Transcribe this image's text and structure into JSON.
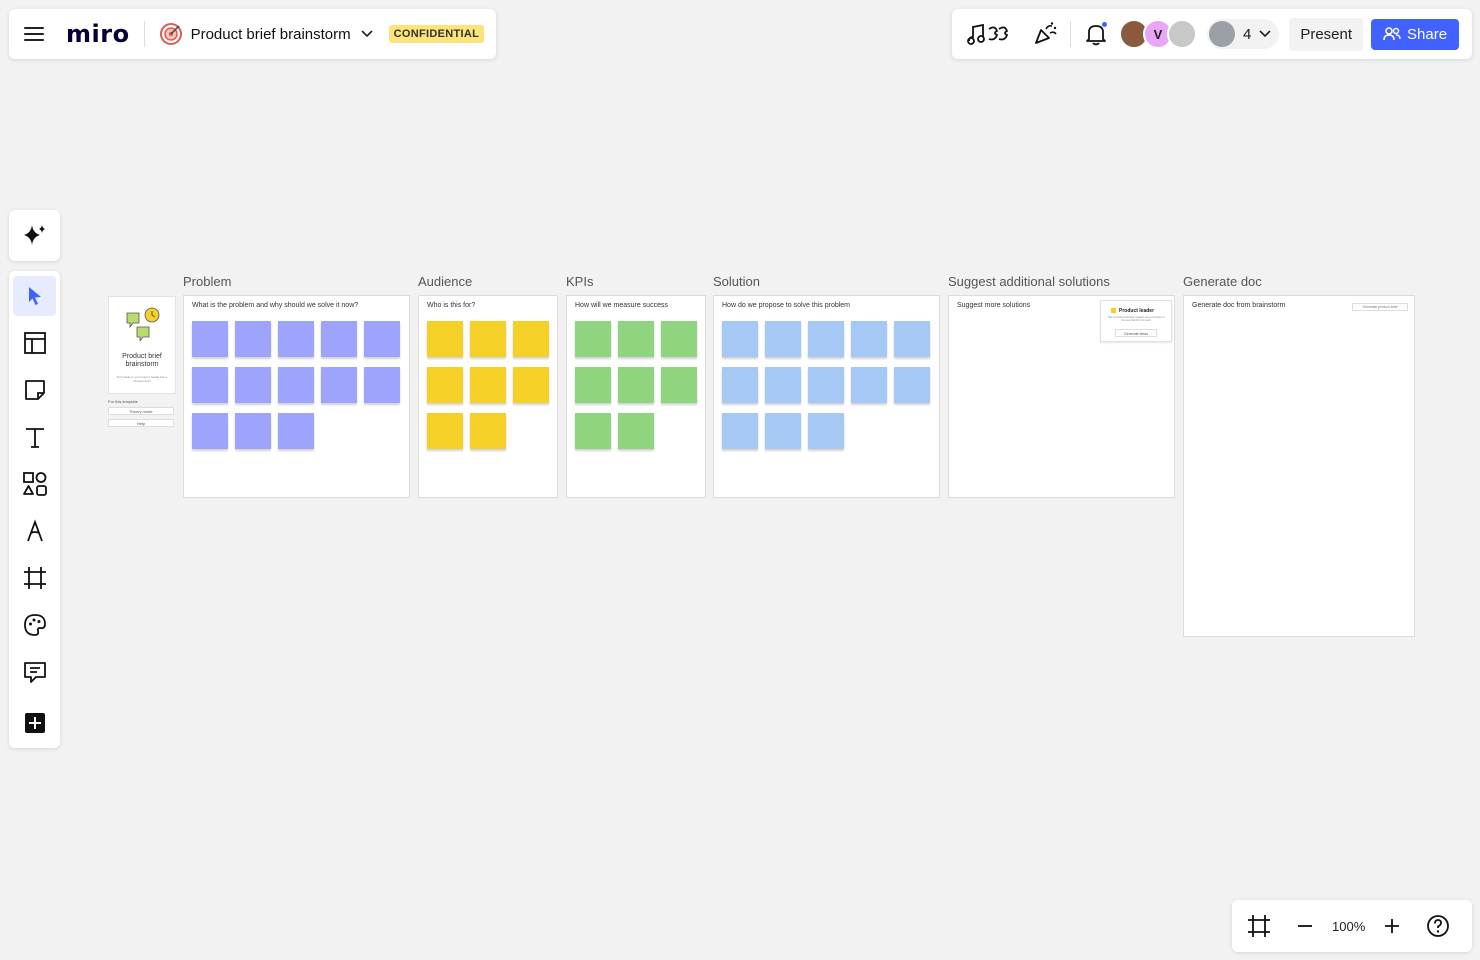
{
  "app": {
    "logo": "miro"
  },
  "board": {
    "title": "Product brief brainstorm",
    "badge": "CONFIDENTIAL"
  },
  "header": {
    "collaborators_count": "4",
    "avatars": [
      {
        "initial": "",
        "color": "#8a5a3c"
      },
      {
        "initial": "V",
        "color": "#e9a6f5"
      },
      {
        "initial": "",
        "color": "#c8c8c8"
      }
    ],
    "present_label": "Present",
    "share_label": "Share"
  },
  "toolbar": {
    "tools": [
      "ai-sparkle",
      "select",
      "templates",
      "sticky-note",
      "text",
      "shapes",
      "pen",
      "frame",
      "stickers",
      "comment",
      "more"
    ]
  },
  "zoom": {
    "level": "100%"
  },
  "thumbnail": {
    "title": "Product brief brainstorm",
    "subtitle": "Turn ideas in your team's heads into a Product brief",
    "section_label": "For this template",
    "button1": "Theory mode",
    "button2": "Help"
  },
  "frames": [
    {
      "label": "Problem",
      "question": "What is the problem and why should we solve it now?",
      "color": "purple",
      "notes": 13
    },
    {
      "label": "Audience",
      "question": "Who is this for?",
      "color": "yellow",
      "notes": 8
    },
    {
      "label": "KPIs",
      "question": "How will we measure success",
      "color": "green",
      "notes": 8
    },
    {
      "label": "Solution",
      "question": "How do we propose to solve this problem",
      "color": "blue",
      "notes": 13
    },
    {
      "label": "Suggest additional solutions",
      "question": "Suggest more solutions",
      "color": "",
      "notes": 0
    },
    {
      "label": "Generate doc",
      "question": "Generate doc from brainstorm",
      "color": "",
      "notes": 0
    }
  ],
  "suggest_card": {
    "title": "Product leader",
    "body": "This is product principal: suggest some concepts of the area that fit in the work",
    "button": "Generate ideas"
  },
  "generate_button": "Generate product brief",
  "colors": {
    "accent": "#4262ff",
    "badge": "#fce37a"
  }
}
